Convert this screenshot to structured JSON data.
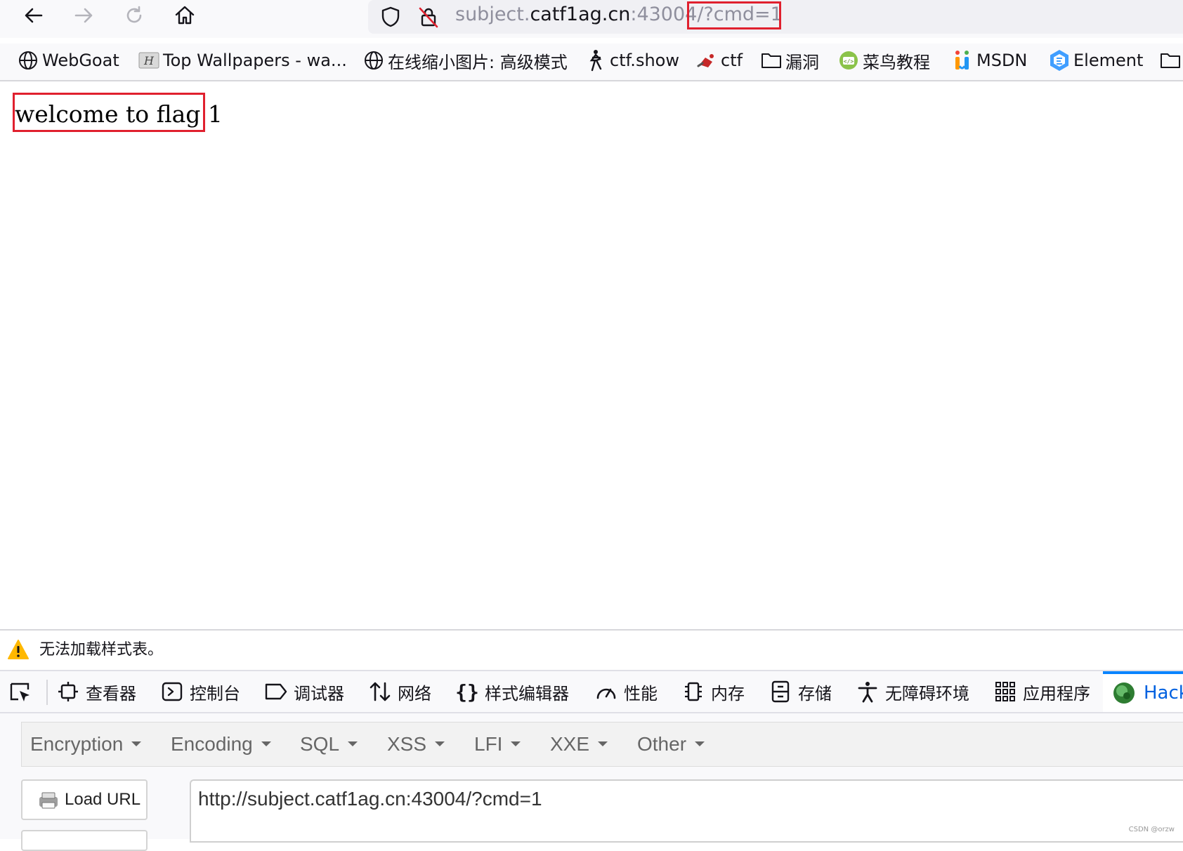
{
  "browser": {
    "url_scheme_host_dim": "subject.",
    "url_host": "catf1ag.cn",
    "url_port_path": ":43004/",
    "url_query": "?cmd=1"
  },
  "bookmarks": [
    {
      "label": "WebGoat",
      "icon": "globe-icon"
    },
    {
      "label": "Top Wallpapers - wa...",
      "icon": "wallpaper-site-icon"
    },
    {
      "label": "在线缩小图片: 高级模式",
      "icon": "globe-icon"
    },
    {
      "label": "ctf.show",
      "icon": "ctfshow-icon"
    },
    {
      "label": "ctf",
      "icon": "ctf-icon"
    },
    {
      "label": "漏洞",
      "icon": "folder-icon"
    },
    {
      "label": "菜鸟教程",
      "icon": "runoob-icon"
    },
    {
      "label": "MSDN",
      "icon": "msdn-icon"
    },
    {
      "label": "Element",
      "icon": "element-icon"
    }
  ],
  "page": {
    "welcome_text": "welcome to flag 1"
  },
  "devtools": {
    "warning_text": "无法加载样式表。",
    "tabs": [
      {
        "label": "查看器",
        "icon": "inspector-icon"
      },
      {
        "label": "控制台",
        "icon": "console-icon"
      },
      {
        "label": "调试器",
        "icon": "debugger-icon"
      },
      {
        "label": "网络",
        "icon": "network-icon"
      },
      {
        "label": "样式编辑器",
        "icon": "style-editor-icon"
      },
      {
        "label": "性能",
        "icon": "performance-icon"
      },
      {
        "label": "内存",
        "icon": "memory-icon"
      },
      {
        "label": "存储",
        "icon": "storage-icon"
      },
      {
        "label": "无障碍环境",
        "icon": "accessibility-icon"
      },
      {
        "label": "应用程序",
        "icon": "application-icon"
      }
    ],
    "active_tab": "Hack"
  },
  "hackbar": {
    "menus": [
      "Encryption",
      "Encoding",
      "SQL",
      "XSS",
      "LFI",
      "XXE",
      "Other"
    ],
    "load_url_label": "Load URL",
    "url_value": "http://subject.catf1ag.cn:43004/?cmd=1"
  },
  "watermark": "CSDN @orzw",
  "colors": {
    "highlight_red": "#e0202e",
    "active_tab_blue": "#0a84ff",
    "toolbar_bg": "#f9f9fb",
    "urlbar_bg": "#f0f0f4"
  }
}
